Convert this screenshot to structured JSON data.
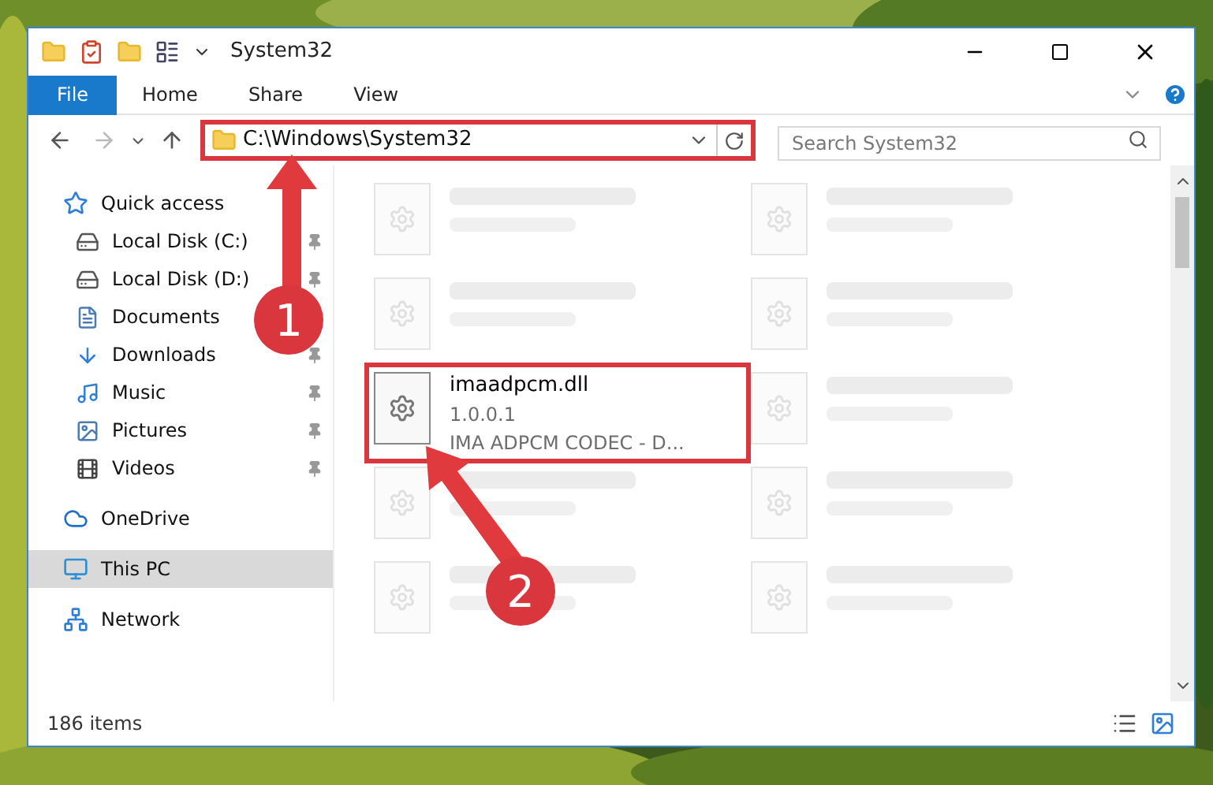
{
  "window": {
    "title": "System32"
  },
  "ribbon_tabs": [
    {
      "label": "File",
      "kind": "file"
    },
    {
      "label": "Home",
      "kind": "tab"
    },
    {
      "label": "Share",
      "kind": "tab"
    },
    {
      "label": "View",
      "kind": "tab"
    }
  ],
  "address": {
    "value": "C:\\Windows\\System32",
    "highlighted": true
  },
  "search": {
    "placeholder": "Search System32"
  },
  "sidebar": [
    {
      "label": "Quick access",
      "selected": false,
      "children": [
        {
          "label": "Local Disk (C:)",
          "pinned": true
        },
        {
          "label": "Local Disk (D:)",
          "pinned": true
        },
        {
          "label": "Documents"
        },
        {
          "label": "Downloads",
          "pinned": true
        },
        {
          "label": "Music",
          "pinned": true
        },
        {
          "label": "Pictures",
          "pinned": true
        },
        {
          "label": "Videos",
          "pinned": true
        }
      ]
    },
    {
      "label": "OneDrive",
      "selected": false
    },
    {
      "label": "This PC",
      "selected": true
    },
    {
      "label": "Network",
      "selected": false
    }
  ],
  "files": [
    {
      "kind": "blurred"
    },
    {
      "kind": "blurred"
    },
    {
      "kind": "blurred"
    },
    {
      "kind": "blurred"
    },
    {
      "kind": "file",
      "name": "imaadpcm.dll",
      "lines": [
        "1.0.0.1",
        "IMA ADPCM CODEC - D..."
      ],
      "highlighted": true
    },
    {
      "kind": "blurred"
    },
    {
      "kind": "blurred"
    },
    {
      "kind": "blurred"
    },
    {
      "kind": "blurred"
    },
    {
      "kind": "blurred"
    }
  ],
  "status_bar": {
    "count": "186 items"
  },
  "annotations": [
    {
      "label": "1"
    },
    {
      "label": "2"
    }
  ]
}
